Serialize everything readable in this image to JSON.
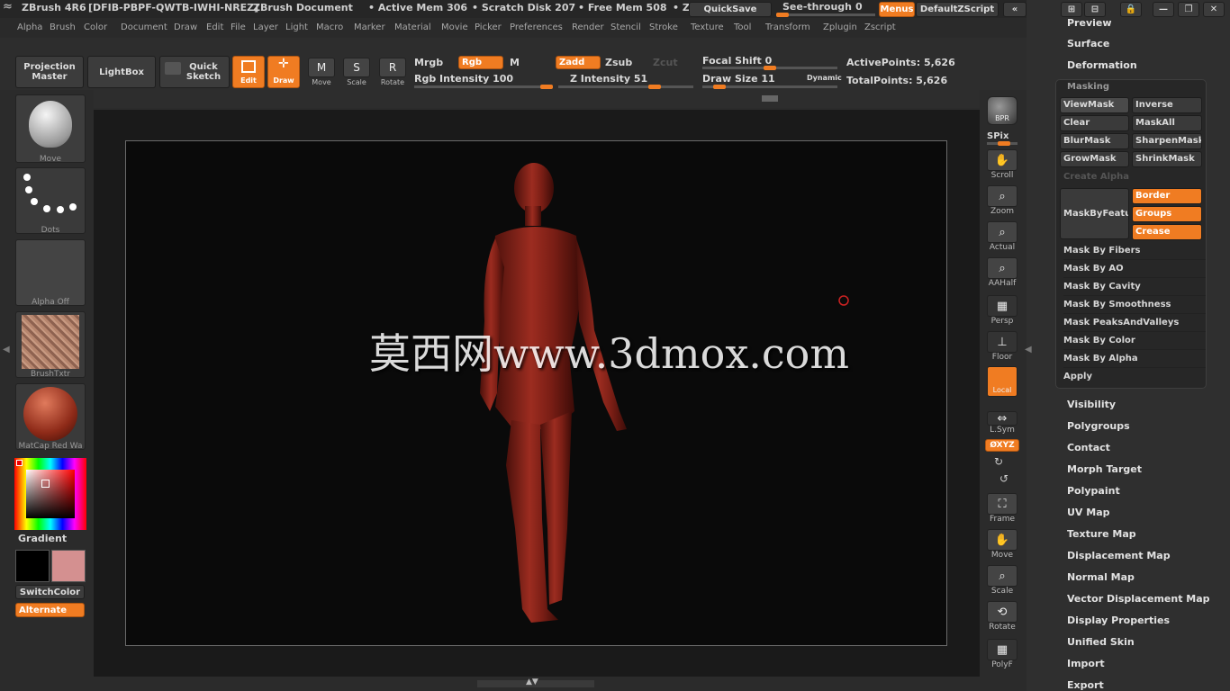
{
  "title_bar": {
    "app": "ZBrush 4R6",
    "serial": "[DFIB-PBPF-QWTB-IWHI-NREZ]",
    "document": "ZBrush Document",
    "active_mem": "• Active Mem 306",
    "scratch_disk": "• Scratch Disk 207",
    "free_mem": "• Free Mem 508",
    "z_trunc": "• Z",
    "quicksave": "QuickSave",
    "see_through": "See-through",
    "see_through_value": "0",
    "menus": "Menus",
    "default_zscript": "DefaultZScript"
  },
  "menus": [
    "Alpha",
    "Brush",
    "Color",
    "Document",
    "Draw",
    "Edit",
    "File",
    "Layer",
    "Light",
    "Macro",
    "Marker",
    "Material",
    "Movie",
    "Picker",
    "Preferences",
    "Render",
    "Stencil",
    "Stroke",
    "Texture",
    "Tool",
    "Transform",
    "Zplugin",
    "Zscript"
  ],
  "toolbar": {
    "projection_master": "Projection Master",
    "lightbox": "LightBox",
    "quick_sketch": "Quick Sketch",
    "edit": "Edit",
    "draw": "Draw",
    "move": "Move",
    "scale": "Scale",
    "rotate": "Rotate",
    "mrgb": "Mrgb",
    "rgb": "Rgb",
    "m": "M",
    "rgb_intensity": "Rgb Intensity 100",
    "zadd": "Zadd",
    "zsub": "Zsub",
    "zcut": "Zcut",
    "z_intensity": "Z Intensity 51",
    "focal_shift": "Focal Shift 0",
    "draw_size": "Draw Size 11",
    "dynamic": "Dynamic",
    "active_points": "ActivePoints: 5,626",
    "total_points": "TotalPoints: 5,626"
  },
  "left_shelf": {
    "brush": "Move",
    "stroke": "Dots",
    "alpha": "Alpha Off",
    "texture": "BrushTxtr",
    "material": "MatCap Red Wa",
    "gradient": "Gradient",
    "switch_color": "SwitchColor",
    "alternate": "Alternate"
  },
  "right_shelf": {
    "bpr": "BPR",
    "spix": "SPix",
    "scroll": "Scroll",
    "zoom": "Zoom",
    "actual": "Actual",
    "aahalf": "AAHalf",
    "persp": "Persp",
    "floor": "Floor",
    "local": "Local",
    "lsym": "L.Sym",
    "xyz": "ØXYZ",
    "frame": "Frame",
    "move": "Move",
    "scale": "Scale",
    "rotate": "Rotate",
    "polyf": "PolyF"
  },
  "canvas": {
    "watermark": "莫西网www.3dmox.com"
  },
  "tray": {
    "preview": "Preview",
    "surface": "Surface",
    "deformation": "Deformation",
    "masking_header": "Masking",
    "mask_buttons": [
      "ViewMask",
      "Inverse",
      "Clear",
      "MaskAll",
      "BlurMask",
      "SharpenMask",
      "GrowMask",
      "ShrinkMask"
    ],
    "create_alpha": "Create Alpha",
    "mask_by_feature": "MaskByFeature",
    "border": "Border",
    "groups": "Groups",
    "crease": "Crease",
    "mask_rows": [
      "Mask By Fibers",
      "Mask By AO",
      "Mask By Cavity",
      "Mask By Smoothness",
      "Mask PeaksAndValleys",
      "Mask By Color",
      "Mask By Alpha",
      "Apply"
    ],
    "sections": [
      "Visibility",
      "Polygroups",
      "Contact",
      "Morph Target",
      "Polypaint",
      "UV Map",
      "Texture Map",
      "Displacement Map",
      "Normal Map",
      "Vector Displacement Map",
      "Display Properties",
      "Unified Skin",
      "Import",
      "Export"
    ]
  },
  "colors": {
    "accent": "#f07c22",
    "model": "#8c231a",
    "secondary_color": "#d49090"
  }
}
